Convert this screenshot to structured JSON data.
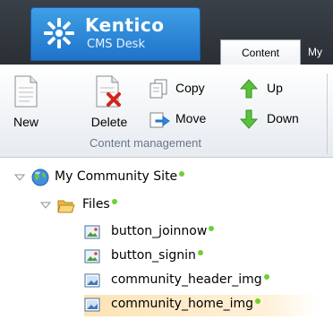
{
  "brand": {
    "title": "Kentico",
    "subtitle": "CMS Desk"
  },
  "tabs": [
    {
      "label": "Content",
      "active": true
    },
    {
      "label": "My"
    }
  ],
  "ribbon": {
    "group_label": "Content management",
    "buttons": {
      "new": "New",
      "delete": "Delete",
      "copy": "Copy",
      "move": "Move",
      "up": "Up",
      "down": "Down"
    }
  },
  "tree": {
    "site": "My Community Site",
    "folder": "Files",
    "items": [
      {
        "label": "button_joinnow",
        "type": "image"
      },
      {
        "label": "button_signin",
        "type": "image"
      },
      {
        "label": "community_header_img",
        "type": "file"
      },
      {
        "label": "community_home_img",
        "type": "file",
        "selected": true
      }
    ]
  },
  "colors": {
    "status_dot": "#6fd02f",
    "selection": "#fde3b5",
    "brand_blue": "#1f73c9"
  }
}
